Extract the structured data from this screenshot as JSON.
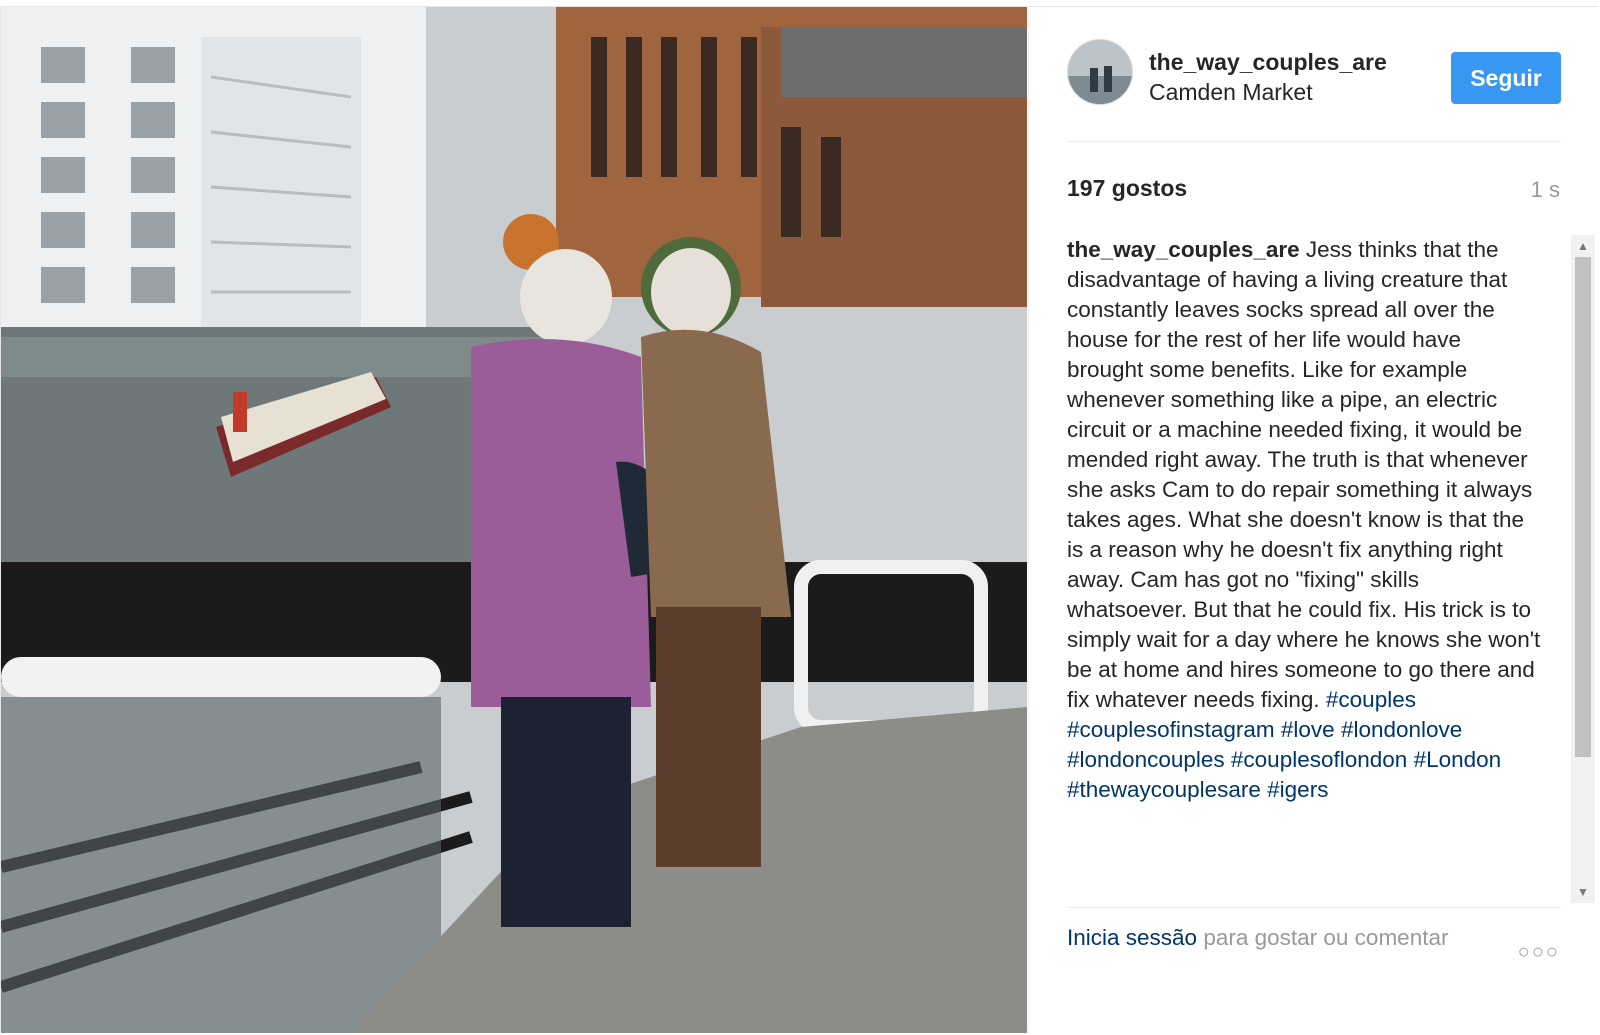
{
  "post": {
    "username": "the_way_couples_are",
    "location": "Camden Market",
    "follow_label": "Seguir",
    "likes": "197 gostos",
    "time": "1 s",
    "caption_user": "the_way_couples_are",
    "caption_text": "Jess thinks that the disadvantage of having a living creature that constantly leaves socks spread all over the house for the rest of her life would have brought some benefits. Like for example whenever something like a pipe, an electric circuit or a machine needed fixing, it would be mended right away. The truth is that whenever she asks Cam to do repair something it always takes ages. What she doesn't know is that the is a reason why he doesn't fix anything right away. Cam has got no \"fixing\" skills whatsoever. But that he could fix. His trick is to simply wait for a day where he knows she won't be at home and hires someone to go there and fix whatever needs fixing.",
    "hashtags": [
      "#couples",
      "#couplesofinstagram",
      "#love",
      "#londonlove",
      "#londoncouples",
      "#couplesoflondon",
      "#London",
      "#thewaycouplesare",
      "#igers"
    ],
    "footer_login": "Inicia sessão",
    "footer_rest": " para gostar ou comentar",
    "more_icon": "ellipsis-icon",
    "accent_color": "#3897f0"
  }
}
